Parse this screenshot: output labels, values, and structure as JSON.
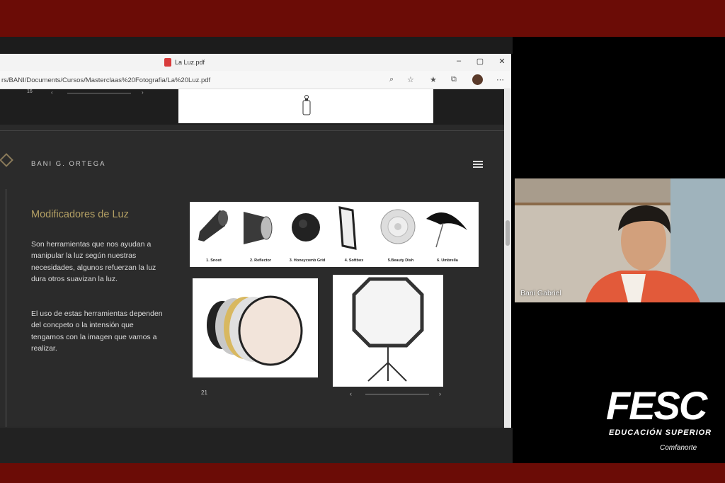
{
  "browser": {
    "tab_title": "La Luz.pdf",
    "url": "rs/BANI/Documents/Cursos/Masterclaas%20Fotografia/La%20Luz.pdf",
    "window_controls": {
      "minimize": "–",
      "maximize": "▢",
      "close": "✕"
    },
    "toolbar_icons": [
      "search-icon",
      "favorite-add-icon",
      "favorites-icon",
      "collections-icon",
      "profile-avatar",
      "more-icon"
    ]
  },
  "prev_page": {
    "page_number": "16"
  },
  "slide": {
    "author": "BANI G. ORTEGA",
    "heading": "Modificadores de Luz",
    "paragraph1": "Son herramientas que nos ayudan a manipular la luz según nuestras necesidades, algunos refuerzan la luz dura otros suavizan la luz.",
    "paragraph2": "El uso de estas herramientas dependen del concpeto o la intensión que tengamos con la imagen que vamos a realizar.",
    "page_number": "21",
    "modifiers": [
      {
        "label": "1. Snoot",
        "icon": "snoot"
      },
      {
        "label": "2. Reflector",
        "icon": "reflector"
      },
      {
        "label": "3. Honeycomb Grid",
        "icon": "honeycomb"
      },
      {
        "label": "4. Softbox",
        "icon": "softbox"
      },
      {
        "label": "5.Beauty Dish",
        "icon": "beauty-dish"
      },
      {
        "label": "6. Umbrella",
        "icon": "umbrella"
      }
    ]
  },
  "webcam": {
    "participant_name": "Bani Gabriel"
  },
  "branding": {
    "main": "FESC",
    "subtitle": "EDUCACIÓN SUPERIOR",
    "partner": "Comfanorte"
  },
  "colors": {
    "band": "#6b0c06",
    "heading_gold": "#b4a064"
  }
}
